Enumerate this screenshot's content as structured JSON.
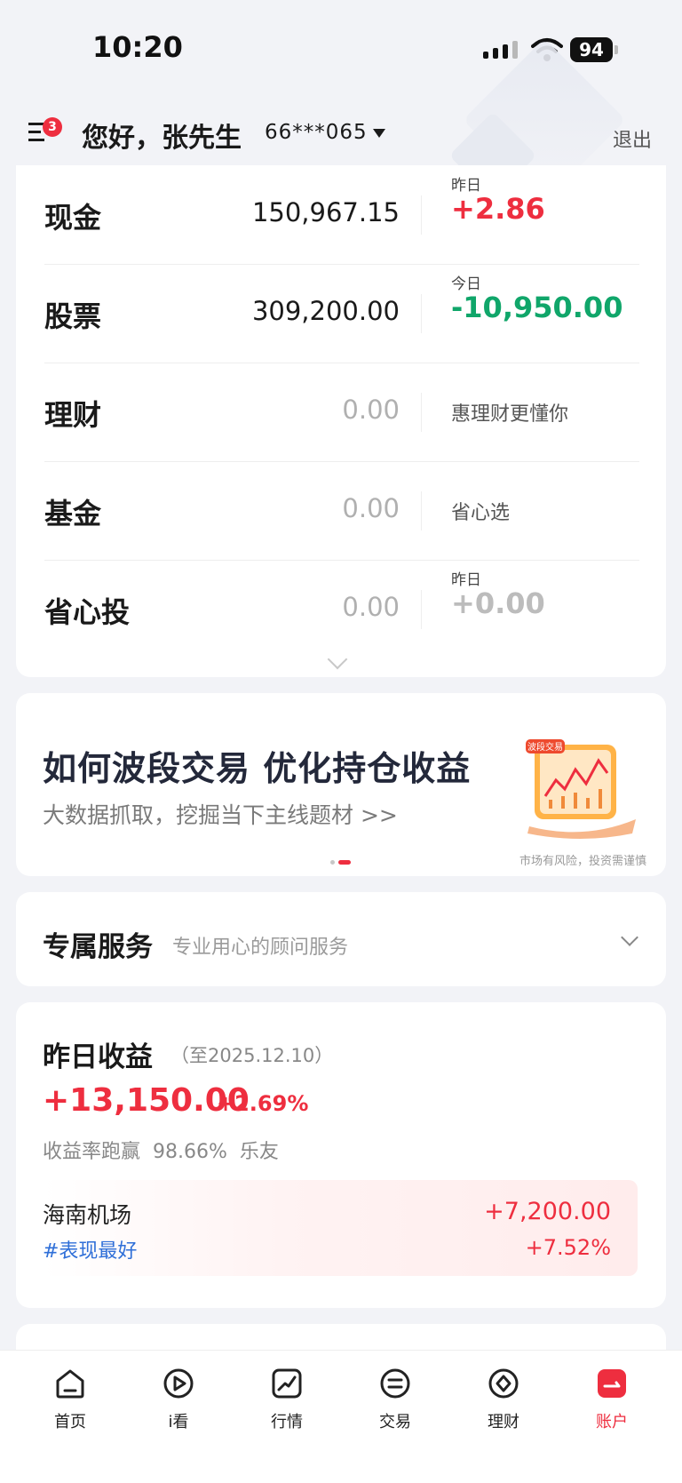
{
  "status_bar": {
    "time": "10:20",
    "battery": "94"
  },
  "header": {
    "menu_badge": "3",
    "greeting": "您好，张先生",
    "account": "66***065",
    "logout": "退出"
  },
  "assets": [
    {
      "name": "现金",
      "value": "150,967.15",
      "side_label": "昨日",
      "side_value": "+2.86",
      "side_color": "red"
    },
    {
      "name": "股票",
      "value": "309,200.00",
      "side_label": "今日",
      "side_value": "-10,950.00",
      "side_color": "green"
    },
    {
      "name": "理财",
      "value": "0.00",
      "side_text": "惠理财更懂你"
    },
    {
      "name": "基金",
      "value": "0.00",
      "side_text": "省心选"
    },
    {
      "name": "省心投",
      "value": "0.00",
      "side_label": "昨日",
      "side_value": "+0.00",
      "side_color": "gray"
    }
  ],
  "banner": {
    "title": "如何波段交易 优化持仓收益",
    "subtitle": "大数据抓取，挖掘当下主线题材 >>",
    "image_tag": "波段交易",
    "risk_note": "市场有风险，投资需谨慎"
  },
  "service": {
    "title": "专属服务",
    "subtitle": "专业用心的顾问服务"
  },
  "earnings": {
    "title": "昨日收益",
    "date": "（至2025.12.10）",
    "amount": "+13,150.00",
    "percent": "+2.69%",
    "rank_label": "收益率跑赢",
    "rank_value": "98.66%",
    "rank_suffix": "乐友",
    "best_stock": {
      "name": "海南机场",
      "tag": "#表现最好",
      "amount": "+7,200.00",
      "percent": "+7.52%"
    }
  },
  "bottom_nav": [
    {
      "label": "首页",
      "icon": "home-icon"
    },
    {
      "label": "i看",
      "icon": "play-icon"
    },
    {
      "label": "行情",
      "icon": "chart-icon"
    },
    {
      "label": "交易",
      "icon": "exchange-icon"
    },
    {
      "label": "理财",
      "icon": "finance-icon"
    },
    {
      "label": "账户",
      "icon": "account-icon",
      "active": true
    }
  ],
  "colors": {
    "accent_red": "#ee2e3f",
    "gain_green": "#10a66a",
    "link_blue": "#2f6fd8"
  }
}
